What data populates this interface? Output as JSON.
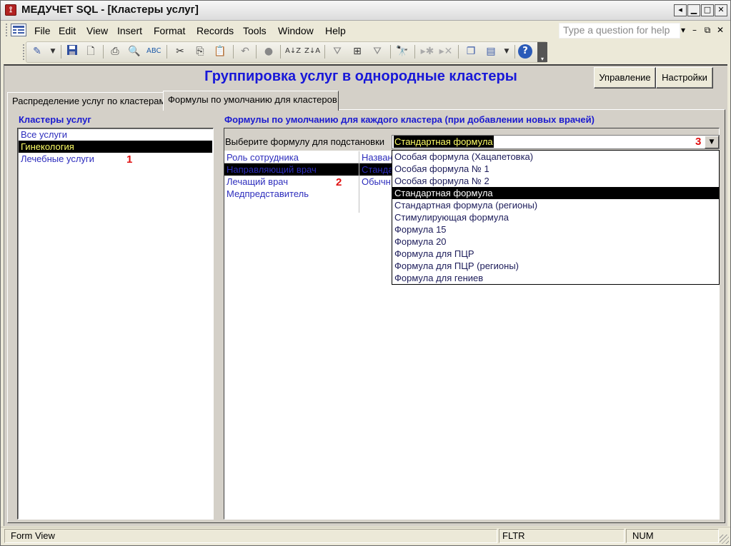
{
  "window": {
    "title": "МЕДУЧЕТ SQL - [Кластеры услуг]",
    "app_icon": "access-icon",
    "caption_buttons": [
      "◂",
      "▁",
      "□",
      "✕"
    ]
  },
  "menu": {
    "items": [
      "File",
      "Edit",
      "View",
      "Insert",
      "Format",
      "Records",
      "Tools",
      "Window",
      "Help"
    ],
    "help_placeholder": "Type a question for help",
    "mdi_controls": [
      "▾",
      "–",
      "⧉",
      "✕"
    ]
  },
  "toolbar": {
    "icons": [
      "design-view-icon",
      "dropdown-arrow-icon",
      "save-icon",
      "file-search-icon",
      "print-icon",
      "print-preview-icon",
      "spelling-icon",
      "cut-icon",
      "copy-icon",
      "paste-icon",
      "undo-icon",
      "hyperlink-icon",
      "sort-ascending-icon",
      "sort-descending-icon",
      "filter-by-selection-icon",
      "filter-by-form-icon",
      "apply-filter-icon",
      "find-icon",
      "new-record-icon",
      "delete-record-icon",
      "database-window-icon",
      "new-object-icon",
      "dropdown-arrow-icon",
      "help-icon",
      "toolbar-options-icon"
    ]
  },
  "form": {
    "title": "Группировка услуг в однородные кластеры",
    "buttons": {
      "manage": "Управление",
      "settings": "Настройки"
    },
    "tabs": [
      "Распределение услуг по кластерам",
      "Формулы по умолчанию для кластеров"
    ],
    "left": {
      "label": "Кластеры услуг",
      "items": [
        "Все услуги",
        "Гинекология",
        "Лечебные услуги"
      ],
      "selected_index": 1,
      "marker": "1"
    },
    "right": {
      "label": "Формулы по умолчанию для каждого кластера (при добавлении новых врачей)",
      "pick_label": "Выберите формулу для подстановки",
      "combo_value": "Стандартная формула",
      "combo_marker": "3",
      "grid": {
        "columns": [
          "Роль сотрудника",
          "Назван"
        ],
        "rows": [
          [
            "Направляющий врач",
            "Стандарт"
          ],
          [
            "Лечащий врач",
            "Обычн"
          ],
          [
            "Медпредставитель",
            ""
          ]
        ],
        "selected_index": 0,
        "marker": "2"
      },
      "dropdown": {
        "options": [
          "Особая формула (Хацапетовка)",
          "Особая формула № 1",
          "Особая формула № 2",
          "Стандартная формула",
          "Стандартная формула (регионы)",
          "Стимулирующая формула",
          "Формула 15",
          "Формула 20",
          "Формула для ПЦР",
          "Формула для ПЦР (регионы)",
          "Формула для гениев"
        ],
        "selected_index": 3
      }
    }
  },
  "status": {
    "mode": "Form View",
    "filter": "FLTR",
    "num": "NUM"
  },
  "colors": {
    "label_blue": "#1a1ad0",
    "list_text": "#2d2dbd",
    "marker_red": "#e01010",
    "selection_bg": "#000000",
    "selection_fg": "#ffff66"
  }
}
